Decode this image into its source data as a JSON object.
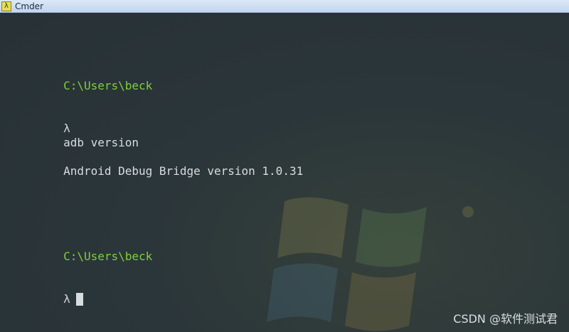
{
  "window": {
    "title": "Cmder",
    "icon_glyph": "λ"
  },
  "console": {
    "lines": [
      {
        "type": "path",
        "text": "C:\\Users\\beck"
      },
      {
        "type": "command",
        "prompt": "λ",
        "text": "adb version"
      },
      {
        "type": "output",
        "text": "Android Debug Bridge version 1.0.31"
      },
      {
        "type": "blank",
        "text": ""
      },
      {
        "type": "path",
        "text": "C:\\Users\\beck"
      },
      {
        "type": "prompt",
        "prompt": "λ",
        "text": ""
      }
    ]
  },
  "watermark": {
    "text": "CSDN @软件测试君"
  },
  "colors": {
    "path": "#7fcf3a",
    "text": "#d8dde0",
    "background": "#283237"
  }
}
